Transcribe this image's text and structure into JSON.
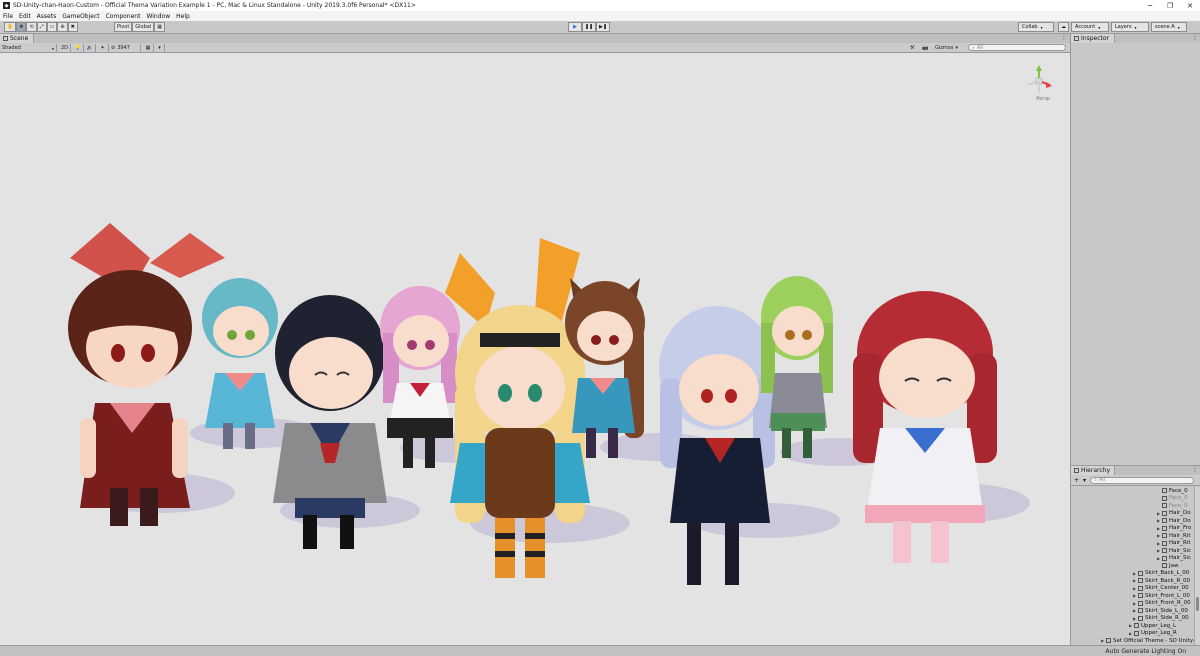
{
  "window": {
    "title": "SD-Unity-chan-Haon-Custom - Official Thema Variation Example 1 - PC, Mac & Linux Standalone - Unity 2019.3.0f6 Personal* <DX11>",
    "controls": [
      "─",
      "❐",
      "✕"
    ]
  },
  "menu": [
    "File",
    "Edit",
    "Assets",
    "GameObject",
    "Component",
    "Window",
    "Help"
  ],
  "toolbar": {
    "tools": [
      "✋",
      "✥",
      "⟲",
      "⤢",
      "▭",
      "⊕",
      "✖"
    ],
    "pivot_label": "Pivot",
    "global_label": "Global",
    "play_icons": [
      "▶",
      "❚❚",
      "▶❚"
    ],
    "collab_label": "Collab",
    "account_label": "Account",
    "layers_label": "Layers",
    "layout_label": "scene A"
  },
  "scene": {
    "tab_label": "Scene",
    "shading_mode": "Shaded",
    "mode_2d": "2D",
    "stats": "3947",
    "gizmos_label": "Gizmos",
    "search_placeholder": "All",
    "gizmo_label": "Persp"
  },
  "inspector": {
    "tab_label": "Inspector"
  },
  "hierarchy": {
    "tab_label": "Hierarchy",
    "add_label": "+",
    "search_placeholder": "All",
    "items": [
      {
        "label": "Face_0",
        "dim": false
      },
      {
        "label": "Face_0",
        "dim": true
      },
      {
        "label": "Face_0",
        "dim": true
      },
      {
        "label": "Hair_Do",
        "dim": false
      },
      {
        "label": "Hair_Do",
        "dim": false
      },
      {
        "label": "Hair_Fro",
        "dim": false
      },
      {
        "label": "Hair_Rit",
        "dim": false
      },
      {
        "label": "Hair_Rit",
        "dim": false
      },
      {
        "label": "Hair_Sic",
        "dim": false
      },
      {
        "label": "Hair_Sic",
        "dim": false
      },
      {
        "label": "Jaw",
        "dim": false
      },
      {
        "label": "Skirt_Back_L_00",
        "dim": false
      },
      {
        "label": "Skirt_Back_R_00",
        "dim": false
      },
      {
        "label": "Skirt_Center_00",
        "dim": false
      },
      {
        "label": "Skirt_Front_L_00",
        "dim": false
      },
      {
        "label": "Skirt_Front_R_00",
        "dim": false
      },
      {
        "label": "Skirt_Side_L_00",
        "dim": false
      },
      {
        "label": "Skirt_Side_R_00",
        "dim": false
      },
      {
        "label": "Upper_Leg_L",
        "dim": false
      },
      {
        "label": "Upper_Leg_R",
        "dim": false
      },
      {
        "label": "Set Official Theme - SD Unity-",
        "dim": false
      }
    ]
  },
  "status": {
    "text": "Auto Generate Lighting On"
  },
  "colors": {
    "viewport_bg": "#e3e3e3",
    "panel_bg": "#c8c8c8",
    "toolbar_bg": "#c8c8c8"
  }
}
